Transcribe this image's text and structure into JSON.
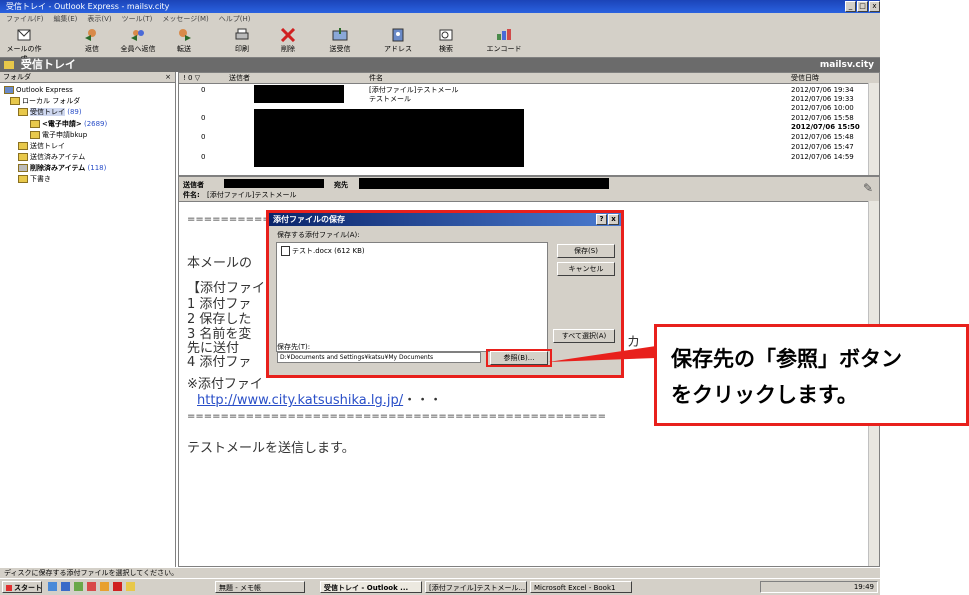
{
  "window": {
    "title": "受信トレイ - Outlook Express - mailsv.city",
    "minimize": "_",
    "maximize": "□",
    "close": "x"
  },
  "menu": [
    "ファイル(F)",
    "編集(E)",
    "表示(V)",
    "ツール(T)",
    "メッセージ(M)",
    "ヘルプ(H)"
  ],
  "toolbar": [
    {
      "label": "メールの作成",
      "icon": "new-mail-icon"
    },
    {
      "label": "返信",
      "icon": "reply-icon"
    },
    {
      "label": "全員へ返信",
      "icon": "reply-all-icon"
    },
    {
      "label": "転送",
      "icon": "forward-icon"
    },
    {
      "label": "印刷",
      "icon": "print-icon"
    },
    {
      "label": "削除",
      "icon": "delete-icon"
    },
    {
      "label": "送受信",
      "icon": "send-receive-icon"
    },
    {
      "label": "アドレス",
      "icon": "address-book-icon"
    },
    {
      "label": "検索",
      "icon": "find-icon"
    },
    {
      "label": "エンコード",
      "icon": "encode-icon"
    }
  ],
  "folder_header": {
    "title": "受信トレイ",
    "account": "mailsv.city"
  },
  "folders": {
    "header": "フォルダ",
    "close": "×",
    "items": [
      {
        "label": "Outlook Express",
        "count": ""
      },
      {
        "label": "ローカル フォルダ",
        "count": ""
      },
      {
        "label": "受信トレイ",
        "count": "(89)"
      },
      {
        "label": "<電子申請>",
        "count": "(2689)"
      },
      {
        "label": "電子申請bkup",
        "count": ""
      },
      {
        "label": "送信トレイ",
        "count": ""
      },
      {
        "label": "送信済みアイテム",
        "count": ""
      },
      {
        "label": "削除済みアイテム",
        "count": "(118)"
      },
      {
        "label": "下書き",
        "count": ""
      }
    ]
  },
  "message_list": {
    "col_flags": "! 0 ▽",
    "col_from": "送信者",
    "col_subject": "件名",
    "col_date": "受信日時",
    "rows": [
      {
        "flag": "0",
        "subject": "[添付ファイル]テストメール",
        "date": "2012/07/06 19:34"
      },
      {
        "flag": "",
        "subject": "テストメール",
        "date": "2012/07/06 19:33"
      },
      {
        "flag": "",
        "subject": "",
        "date": "2012/07/06 10:00"
      },
      {
        "flag": "0",
        "subject": "",
        "date": "2012/07/06 15:58"
      },
      {
        "flag": "",
        "subject": "",
        "date": "2012/07/06 15:50"
      },
      {
        "flag": "0",
        "subject": "",
        "date": "2012/07/06 15:48"
      },
      {
        "flag": "",
        "subject": "",
        "date": "2012/07/06 15:47"
      },
      {
        "flag": "0",
        "subject": "",
        "date": "2012/07/06 14:59"
      }
    ]
  },
  "preview": {
    "from_label": "送信者",
    "to_label": "宛先",
    "subject_label": "件名:",
    "subject_value": "[添付ファイル]テストメール",
    "separator": "================================",
    "intro": "本メールの",
    "section": "【添付ファイ",
    "steps": [
      "1 添付ファ",
      "2 保存した",
      "3 名前を変",
      "  先に送付",
      "4 添付ファ"
    ],
    "note": "※添付ファイ",
    "url": "http://www.city.katsushika.lg.jp/",
    "url_suffix": "・・・",
    "separator2": "==================================================",
    "closing": "テストメールを送信します。",
    "clipped_tail": "カ"
  },
  "dialog": {
    "title": "添付ファイルの保存",
    "help": "?",
    "close": "x",
    "list_label": "保存する添付ファイル(A):",
    "file": "テスト.docx (612 KB)",
    "save_btn": "保存(S)",
    "cancel_btn": "キャンセル",
    "select_all_btn": "すべて選択(A)",
    "dest_label": "保存先(T):",
    "dest_value": "D:¥Documents and Settings¥katsu¥My Documents",
    "browse_btn": "参照(B)..."
  },
  "callout": {
    "line1": "保存先の「参照」ボタン",
    "line2": "をクリックします。"
  },
  "status": "ディスクに保存する添付ファイルを選択してください。",
  "taskbar": {
    "start": "スタート",
    "tasks": [
      "無題 - メモ帳",
      "受信トレイ - Outlook ...",
      "[添付ファイル]テストメール...",
      "Microsoft Excel - Book1"
    ],
    "clock": "19:49"
  },
  "colors": {
    "accent": "#e8201c",
    "titlebar": "#1b44b8",
    "link": "#2a4fc8"
  }
}
